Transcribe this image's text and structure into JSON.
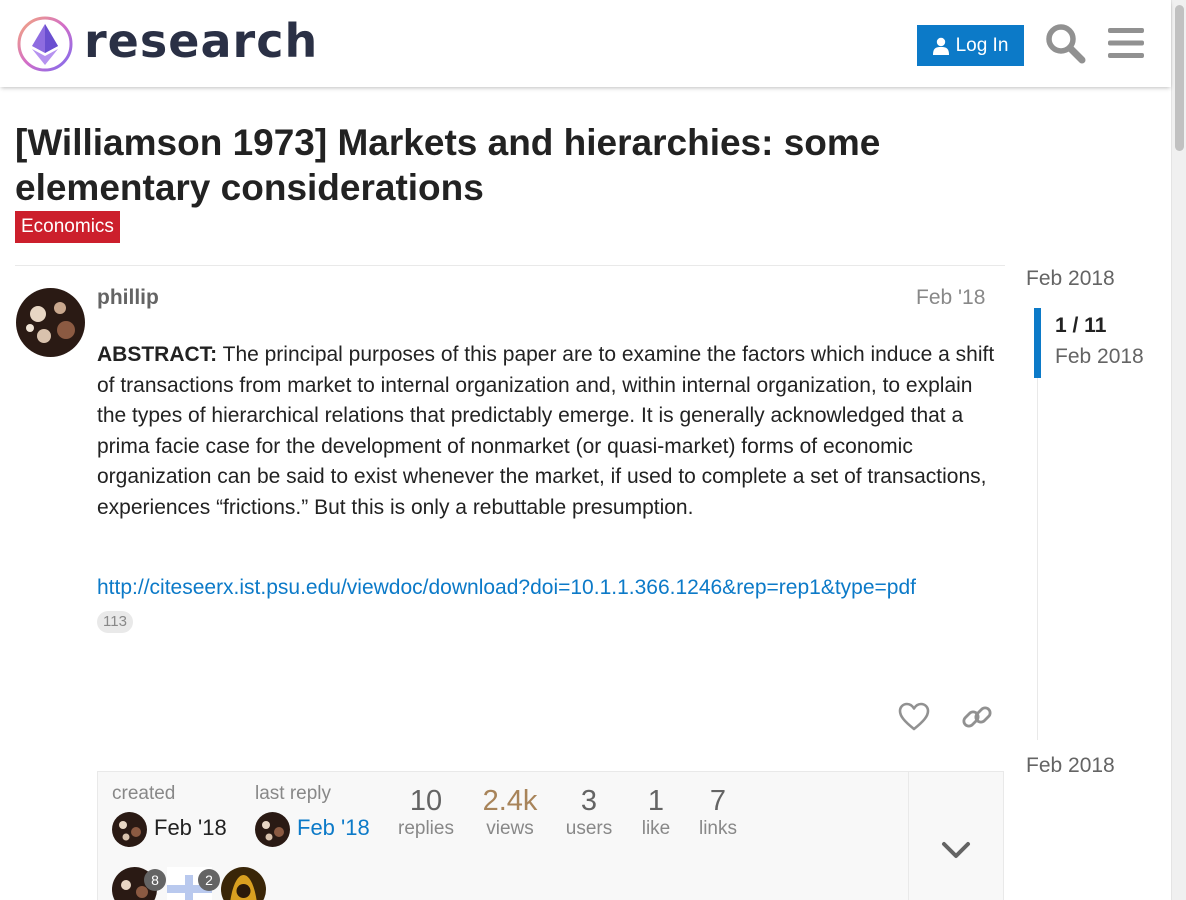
{
  "header": {
    "site_name": "research",
    "login_label": "Log In"
  },
  "topic": {
    "title": "[Williamson 1973] Markets and hierarchies: some elementary considerations",
    "category": "Economics",
    "category_color": "#cc1f2c"
  },
  "post": {
    "username": "phillip",
    "date": "Feb '18",
    "abstract_label": "ABSTRACT:",
    "abstract_text": " The principal purposes of this paper are to examine the factors which induce a shift of transactions from market to internal organization and, within internal organization, to explain the types of hierarchical relations that predictably emerge. It is generally acknowledged that a prima facie case for the development of nonmarket (or quasi-market) forms of economic organization can be said to exist whenever the market, if used to complete a set of transactions, experiences “frictions.” But this is only a rebuttable presumption.",
    "link": "http://citeseerx.ist.psu.edu/viewdoc/download?doi=10.1.1.366.1246&rep=rep1&type=pdf",
    "link_clicks": "113"
  },
  "topic_map": {
    "created_label": "created",
    "created_date": "Feb '18",
    "last_reply_label": "last reply",
    "last_reply_date": "Feb '18",
    "stats": [
      {
        "value": "10",
        "label": "replies"
      },
      {
        "value": "2.4k",
        "label": "views"
      },
      {
        "value": "3",
        "label": "users"
      },
      {
        "value": "1",
        "label": "like"
      },
      {
        "value": "7",
        "label": "links"
      }
    ],
    "participants": [
      {
        "badge": "8"
      },
      {
        "badge": "2"
      },
      {
        "badge": ""
      }
    ]
  },
  "timeline": {
    "top_date": "Feb 2018",
    "position": "1 / 11",
    "current_date": "Feb 2018",
    "bottom_date": "Feb 2018"
  },
  "colors": {
    "accent": "#0c7ac8",
    "hot_views": "#a8845a"
  }
}
